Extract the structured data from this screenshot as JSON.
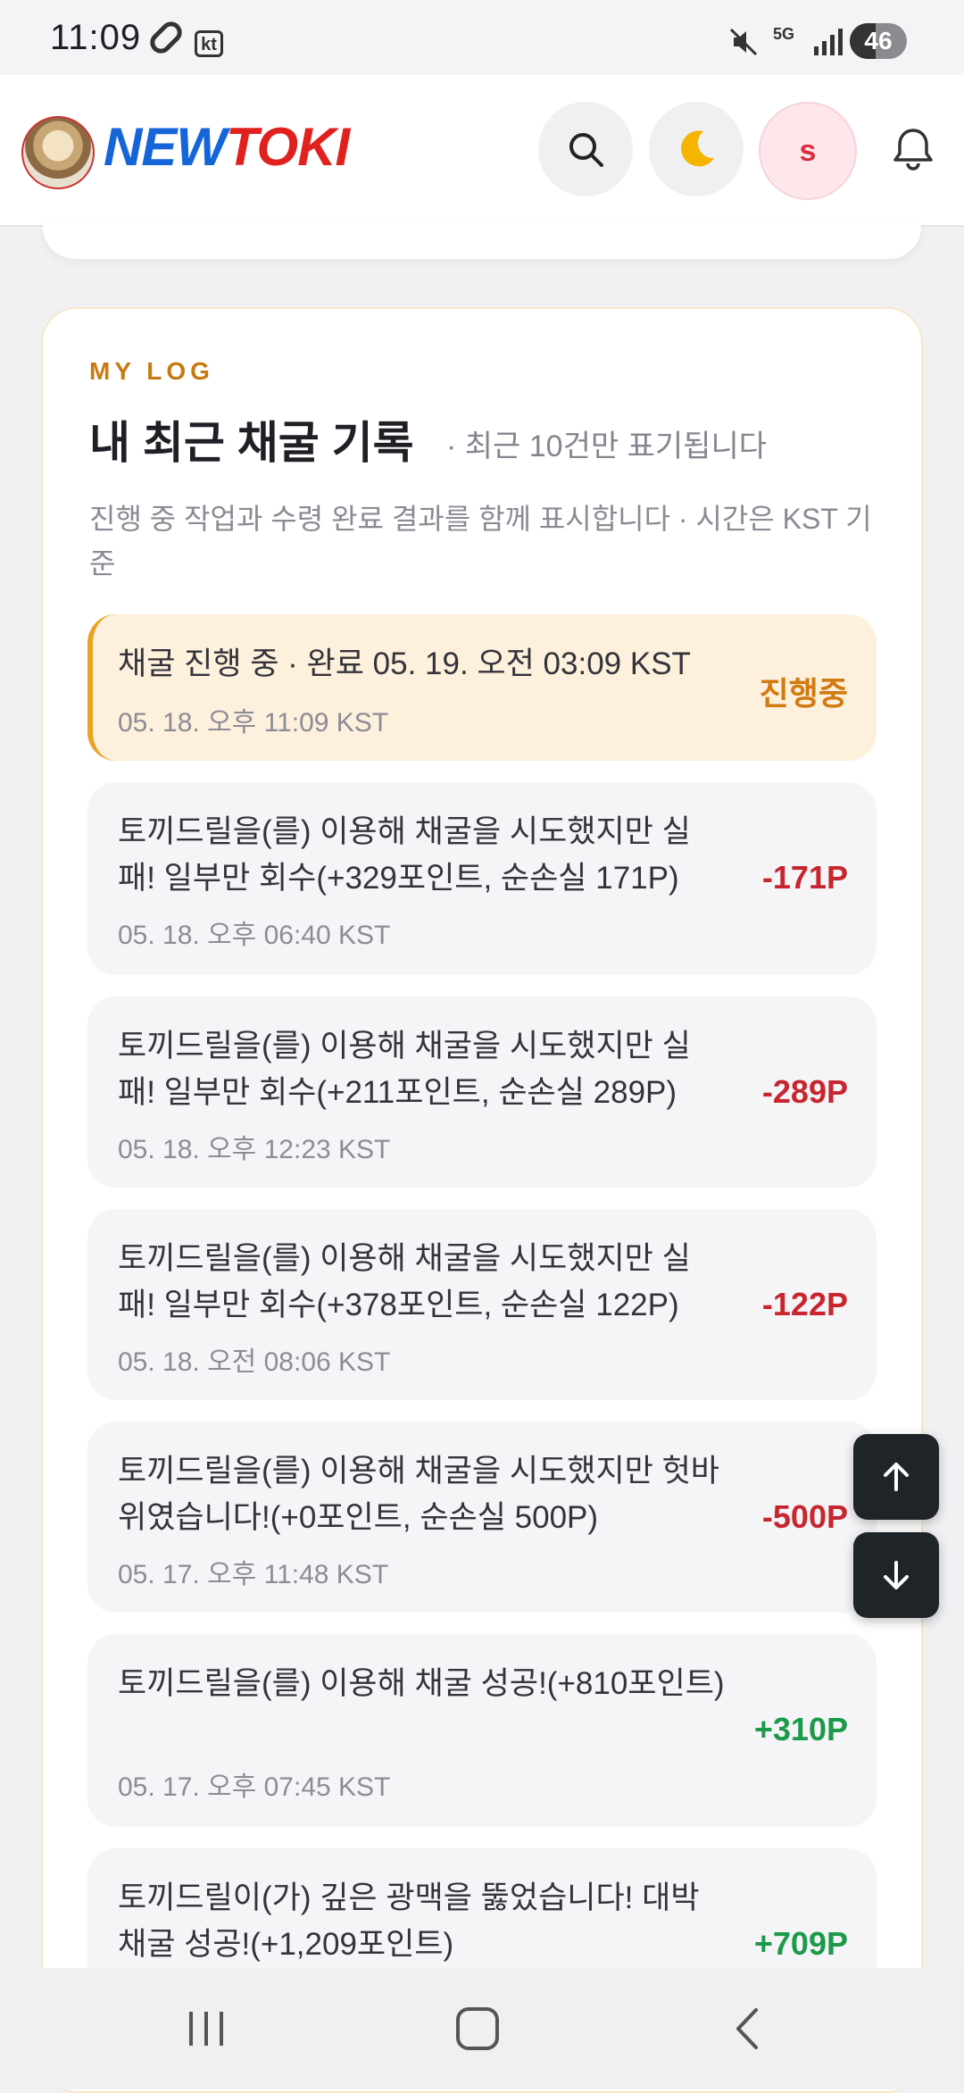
{
  "status_bar": {
    "time": "11:09",
    "carrier_badge": "kt",
    "network": "5G",
    "battery": "46"
  },
  "header": {
    "logo_part1": "NEW",
    "logo_part2": "TOKI",
    "user_initial": "s",
    "icons": [
      "search-icon",
      "moon-icon",
      "bell-icon"
    ]
  },
  "log_card": {
    "eyebrow": "MY LOG",
    "title": "내 최근 채굴 기록",
    "note": "· 최근 10건만 표기됩니다",
    "description": "진행 중 작업과 수령 완료 결과를 함께 표시합니다 · 시간은 KST 기준",
    "items": [
      {
        "text": "채굴 진행 중 · 완료 05. 19. 오전 03:09 KST",
        "time": "05. 18. 오후 11:09 KST",
        "value": "진행중",
        "kind": "progress"
      },
      {
        "text": "토끼드릴을(를) 이용해 채굴을 시도했지만 실패! 일부만 회수(+329포인트, 순손실 171P)",
        "time": "05. 18. 오후 06:40 KST",
        "value": "-171P",
        "kind": "loss"
      },
      {
        "text": "토끼드릴을(를) 이용해 채굴을 시도했지만 실패! 일부만 회수(+211포인트, 순손실 289P)",
        "time": "05. 18. 오후 12:23 KST",
        "value": "-289P",
        "kind": "loss"
      },
      {
        "text": "토끼드릴을(를) 이용해 채굴을 시도했지만 실패! 일부만 회수(+378포인트, 순손실 122P)",
        "time": "05. 18. 오전 08:06 KST",
        "value": "-122P",
        "kind": "loss"
      },
      {
        "text": "토끼드릴을(를) 이용해 채굴을 시도했지만 헛바위였습니다!(+0포인트, 순손실 500P)",
        "time": "05. 17. 오후 11:48 KST",
        "value": "-500P",
        "kind": "loss"
      },
      {
        "text": "토끼드릴을(를) 이용해 채굴 성공!(+810포인트)",
        "time": "05. 17. 오후 07:45 KST",
        "value": "+310P",
        "kind": "gain"
      },
      {
        "text": "토끼드릴이(가) 깊은 광맥을 뚫었습니다! 대박 채굴 성공!(+1,209포인트)",
        "time": "",
        "value": "+709P",
        "kind": "gain"
      }
    ]
  },
  "colors": {
    "accent": "#c77a10",
    "loss": "#c8262f",
    "gain": "#1c9a4a",
    "progress_bg": "#fdf0dc"
  }
}
